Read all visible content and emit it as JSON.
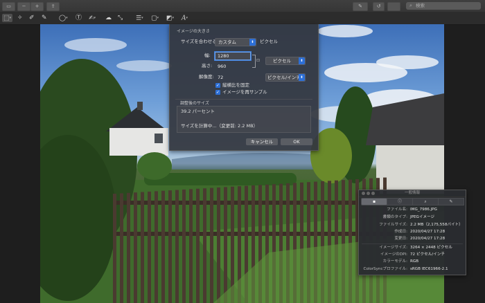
{
  "toolbar": {
    "search_placeholder": "検索",
    "search_icon": "magnifier-icon"
  },
  "markup": {
    "items": [
      "selection-tools-icon",
      "instant-alpha-icon",
      "sketch-icon",
      "draw-icon",
      "shapes-icon",
      "text-icon",
      "sign-icon",
      "adjust-color-icon",
      "adjust-size-icon",
      "shape-style-icon",
      "border-color-icon",
      "fill-color-icon",
      "text-style-icon"
    ],
    "text_style_glyph": "A"
  },
  "dialog": {
    "title": "イメージの大きさ",
    "fit_label": "サイズを合わせる:",
    "fit_value": "カスタム",
    "fit_unit": "ピクセル",
    "width_label": "幅:",
    "width_value": "1280",
    "height_label": "高さ:",
    "height_value": "960",
    "resolution_label": "解像度:",
    "resolution_value": "72",
    "size_unit": "ピクセル",
    "resolution_unit": "ピクセル/インチ",
    "proportional_label": "縦横比を固定",
    "resample_label": "イメージを再サンプル",
    "result_header": "調整後のサイズ",
    "result_percent": "39.2 パーセント",
    "result_size": "サイズを計算中…（変更前: 2.2 MB）",
    "cancel": "キャンセル",
    "ok": "OK"
  },
  "inspector": {
    "title": "一般情報",
    "tabs": [
      "file-icon",
      "info-icon",
      "magnifier-icon",
      "pencil-icon"
    ],
    "rows": [
      {
        "k": "ファイル名:",
        "v": "IMG_7986.JPG"
      },
      {
        "k": "書類のタイプ:",
        "v": "JPEGイメージ"
      },
      {
        "k": "ファイルサイズ:",
        "v": "2.2 MB（2,175,558バイト）"
      },
      {
        "k": "作成日:",
        "v": "2020/04/27 17:28"
      },
      {
        "k": "変更日:",
        "v": "2020/04/27 17:28"
      },
      {
        "k": "イメージサイズ:",
        "v": "3264 × 2448 ピクセル"
      },
      {
        "k": "イメージのDPI:",
        "v": "72 ピクセル/インチ"
      },
      {
        "k": "カラーモデル:",
        "v": "RGB"
      },
      {
        "k": "ColorSyncプロファイル:",
        "v": "sRGB IEC61966-2.1"
      }
    ]
  },
  "colors": {
    "accent": "#2d6fd6",
    "toolbar": "#3a3a3a",
    "dialog": "#34373e"
  }
}
